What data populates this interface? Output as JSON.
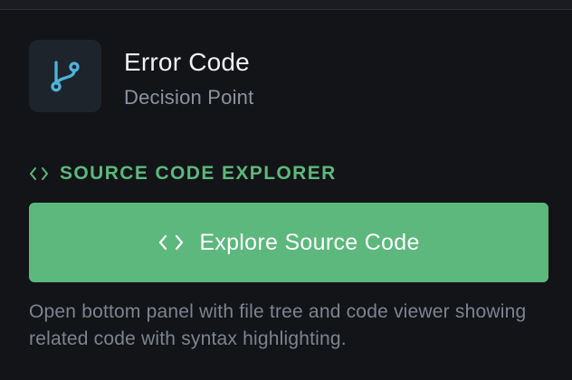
{
  "node": {
    "icon": "git-branch-icon",
    "title": "Error Code",
    "subtitle": "Decision Point"
  },
  "section": {
    "icon": "code-brackets-icon",
    "label": "SOURCE CODE EXPLORER"
  },
  "explore_button": {
    "icon": "code-brackets-icon",
    "label": "Explore Source Code"
  },
  "description": "Open bottom panel with file tree and code viewer showing related code with syntax highlighting.",
  "colors": {
    "background": "#131417",
    "accent_green": "#5cb87c",
    "icon_blue": "#4fb3d9"
  }
}
